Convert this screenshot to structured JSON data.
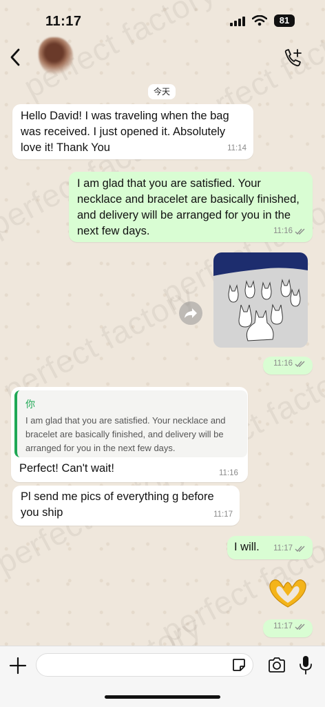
{
  "status": {
    "time": "11:17",
    "battery": "81"
  },
  "watermark": "perfect factory",
  "date_chip": "今天",
  "messages": [
    {
      "text": "Hello David! I was traveling when the bag was received. I just opened it. Absolutely love it! Thank You",
      "time": "11:14"
    },
    {
      "text": "I am glad that you are satisfied. Your necklace and bracelet are basically finished, and delivery will be arranged for you in the next few days.",
      "time": "11:16"
    },
    {
      "time": "11:16"
    },
    {
      "quote_author": "你",
      "quote_text": "I am glad that you are satisfied. Your necklace and bracelet are basically finished, and delivery will be arranged for you in the next few days.",
      "text": "Perfect! Can't wait!",
      "time": "11:16"
    },
    {
      "text": "Pl send me pics of everything g before you ship",
      "time": "11:17"
    },
    {
      "text": "I will.",
      "time": "11:17"
    },
    {
      "time": "11:17"
    }
  ],
  "colors": {
    "outgoing": "#d9fdd3",
    "incoming": "#ffffff",
    "quote_accent": "#1fa855"
  }
}
